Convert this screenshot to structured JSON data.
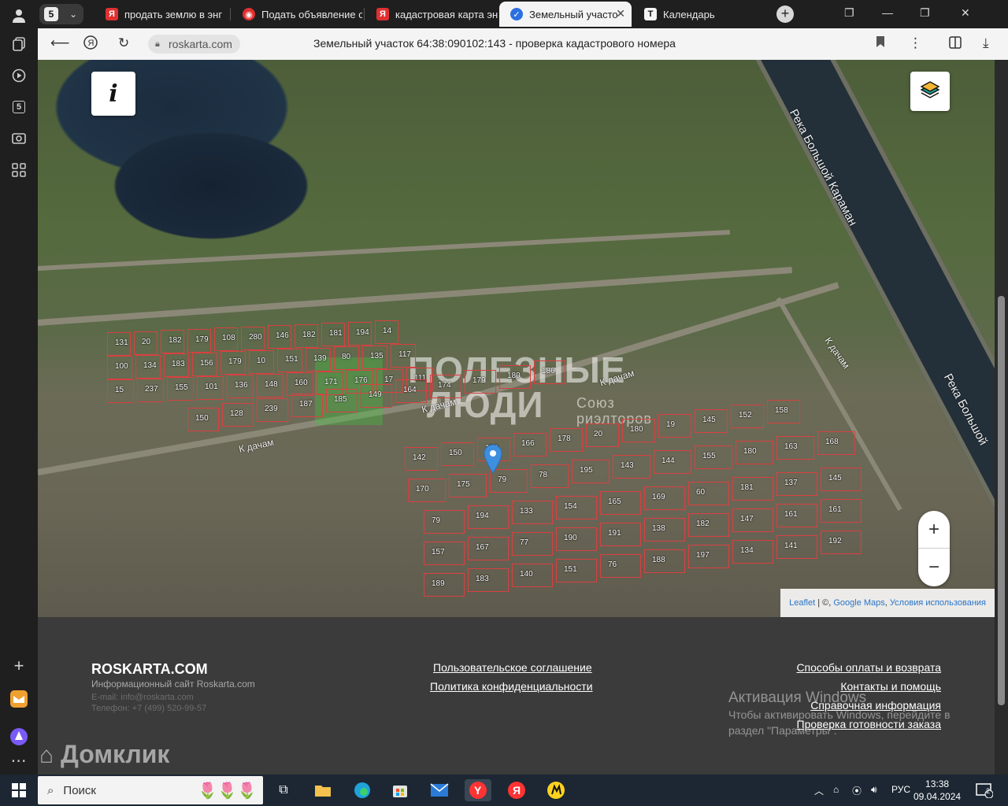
{
  "browser": {
    "tab_count": "5",
    "tabs": [
      {
        "label": "продать землю в энг",
        "favicon": "Я",
        "color": "#e03030"
      },
      {
        "label": "Подать объявление с",
        "favicon": "A",
        "color": "#e03030"
      },
      {
        "label": "кадастровая карта эн",
        "favicon": "Я",
        "color": "#e03030"
      },
      {
        "label": "Земельный участо",
        "favicon": "✓",
        "color": "#2c6fe0",
        "active": true
      },
      {
        "label": "Календарь",
        "favicon": "T",
        "color": "#222"
      }
    ],
    "url": "roskarta.com",
    "page_title": "Земельный участок 64:38:090102:143 - проверка кадастрового номера"
  },
  "map": {
    "river_label_1": "Река Большой Караман",
    "river_label_2": "Река Большой",
    "road_label": "К дачам",
    "watermark_line1": "ПОЛЕЗНЫЕ",
    "watermark_line2": "ЛЮДИ",
    "watermark_sub": "Союз\nриэлторов",
    "zoom_in": "+",
    "zoom_out": "−",
    "info_icon": "i",
    "attribution": {
      "leaflet": "Leaflet",
      "sep": " | ©, ",
      "google": "Google Maps",
      "terms": "Условия использования"
    },
    "plots": [
      "131",
      "20",
      "182",
      "179",
      "108",
      "280",
      "146",
      "182",
      "181",
      "194",
      "14",
      "100",
      "134",
      "183",
      "156",
      "179",
      "10",
      "151",
      "139",
      "80",
      "135",
      "117",
      "15",
      "237",
      "155",
      "101",
      "136",
      "148",
      "160",
      "171",
      "176",
      "17",
      "111",
      "150",
      "128",
      "239",
      "187",
      "185",
      "149",
      "164",
      "174",
      "179",
      "180",
      "186",
      "142",
      "150",
      "153",
      "166",
      "178",
      "20",
      "180",
      "19",
      "145",
      "152",
      "158",
      "170",
      "175",
      "79",
      "78",
      "195",
      "143",
      "144",
      "155",
      "180",
      "163",
      "168",
      "79",
      "194",
      "133",
      "154",
      "165",
      "169",
      "60",
      "181",
      "137",
      "145",
      "157",
      "167",
      "77",
      "190",
      "191",
      "138",
      "182",
      "147",
      "161",
      "161",
      "189",
      "183",
      "140",
      "151",
      "76",
      "188",
      "197",
      "134",
      "141",
      "192"
    ]
  },
  "footer": {
    "brand": "ROSKARTA.COM",
    "tagline": "Информационный сайт Roskarta.com",
    "email": "E-mail: info@roskarta.com",
    "phone": "Телефон: +7 (499) 520-99-57",
    "links_center": [
      "Пользовательское соглашение",
      "Политика конфиденциальности"
    ],
    "links_right": [
      "Способы оплаты и возврата",
      "Контакты и помощь",
      "Справочная информация",
      "Проверка готовности заказа"
    ],
    "activation_title": "Активация Windows",
    "activation_text": "Чтобы активировать Windows, перейдите в раздел \"Параметры\".",
    "domclick": "Домклик"
  },
  "taskbar": {
    "search_placeholder": "Поиск",
    "lang": "РУС",
    "time": "13:38",
    "date": "09.04.2024",
    "notifications": "2"
  }
}
